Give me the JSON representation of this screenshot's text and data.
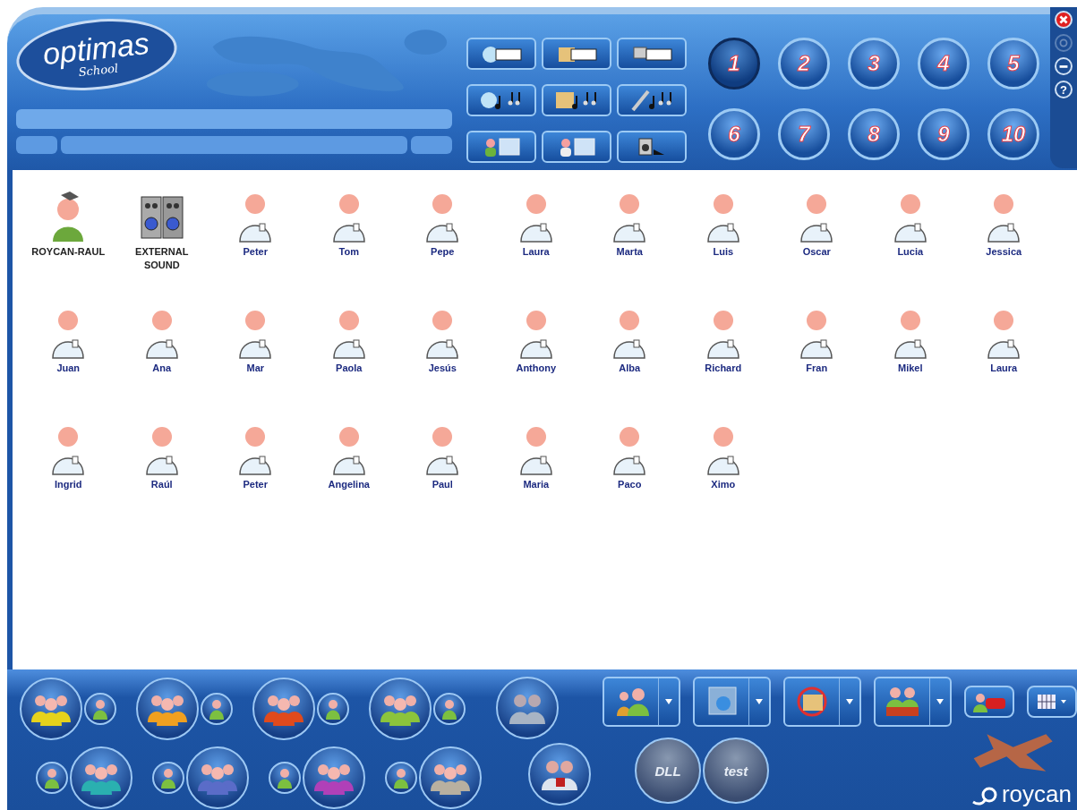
{
  "logo": {
    "name": "optimas",
    "edition": "School"
  },
  "channels": [
    {
      "label": "1",
      "selected": true
    },
    {
      "label": "2",
      "selected": false
    },
    {
      "label": "3",
      "selected": false
    },
    {
      "label": "4",
      "selected": false
    },
    {
      "label": "5",
      "selected": false
    },
    {
      "label": "6",
      "selected": false
    },
    {
      "label": "7",
      "selected": false
    },
    {
      "label": "8",
      "selected": false
    },
    {
      "label": "9",
      "selected": false
    },
    {
      "label": "10",
      "selected": false
    }
  ],
  "window_controls": [
    {
      "kind": "close",
      "disabled": false
    },
    {
      "kind": "settings",
      "disabled": true
    },
    {
      "kind": "minimize",
      "disabled": false
    },
    {
      "kind": "help",
      "disabled": false,
      "label": "?"
    }
  ],
  "students": [
    {
      "name": "ROYCAN-RAUL",
      "kind": "teacher"
    },
    {
      "name": "EXTERNAL SOUND",
      "kind": "speaker"
    },
    {
      "name": "Peter",
      "kind": "student"
    },
    {
      "name": "Tom",
      "kind": "student"
    },
    {
      "name": "Pepe",
      "kind": "student"
    },
    {
      "name": "Laura",
      "kind": "student"
    },
    {
      "name": "Marta",
      "kind": "student"
    },
    {
      "name": "Luis",
      "kind": "student"
    },
    {
      "name": "Oscar",
      "kind": "student"
    },
    {
      "name": "Lucia",
      "kind": "student"
    },
    {
      "name": "Jessica",
      "kind": "student"
    },
    {
      "name": "Juan",
      "kind": "student"
    },
    {
      "name": "Ana",
      "kind": "student"
    },
    {
      "name": "Mar",
      "kind": "student"
    },
    {
      "name": "Paola",
      "kind": "student"
    },
    {
      "name": "Jesús",
      "kind": "student"
    },
    {
      "name": "Anthony",
      "kind": "student"
    },
    {
      "name": "Alba",
      "kind": "student"
    },
    {
      "name": "Richard",
      "kind": "student"
    },
    {
      "name": "Fran",
      "kind": "student"
    },
    {
      "name": "Mikel",
      "kind": "student"
    },
    {
      "name": "Laura",
      "kind": "student"
    },
    {
      "name": "Ingrid",
      "kind": "student"
    },
    {
      "name": "Raúl",
      "kind": "student"
    },
    {
      "name": "Peter",
      "kind": "student"
    },
    {
      "name": "Angelina",
      "kind": "student"
    },
    {
      "name": "Paul",
      "kind": "student"
    },
    {
      "name": "Maria",
      "kind": "student"
    },
    {
      "name": "Paco",
      "kind": "student"
    },
    {
      "name": "Ximo",
      "kind": "student"
    }
  ],
  "groups": [
    {
      "color": "#e6d21c"
    },
    {
      "color": "#f0a020"
    },
    {
      "color": "#e04a1c"
    },
    {
      "color": "#8cc43c"
    },
    {
      "color": "#2ab0b0"
    },
    {
      "color": "#5a6cc8"
    },
    {
      "color": "#b040b8"
    },
    {
      "color": "#b8b0a0"
    }
  ],
  "tools": [
    {
      "label": "DLL"
    },
    {
      "label": "test"
    }
  ],
  "brand": "roycan"
}
